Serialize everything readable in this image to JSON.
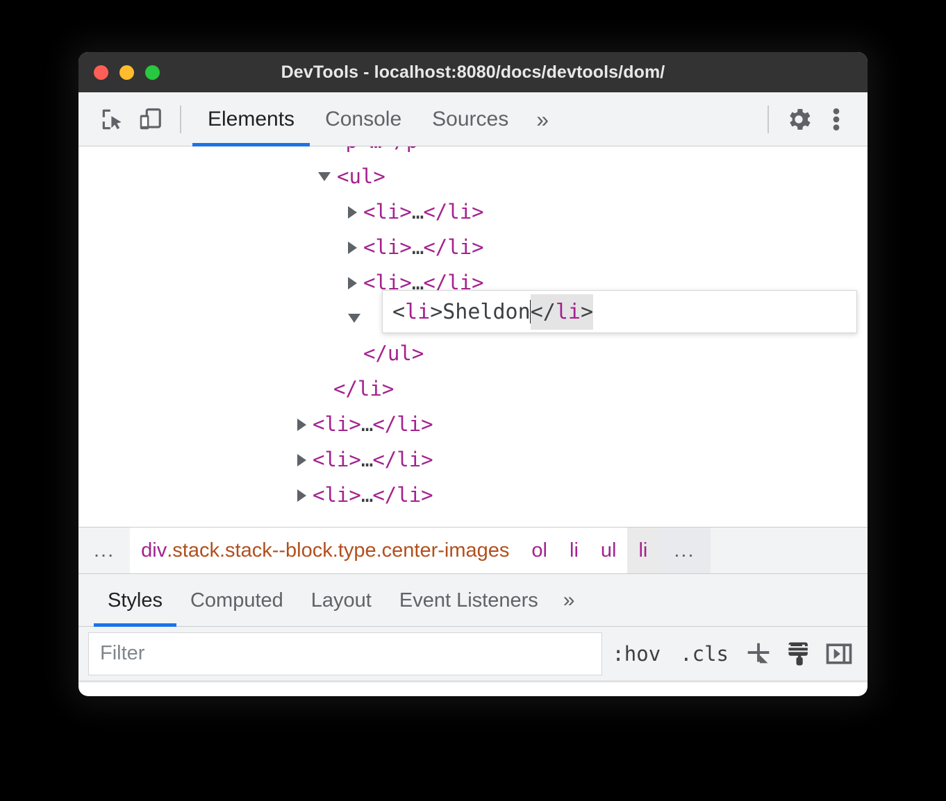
{
  "window": {
    "title": "DevTools - localhost:8080/docs/devtools/dom/",
    "traffic_lights": [
      "close-red",
      "minimize-amber",
      "maximize-green"
    ],
    "colors": {
      "titlebar_bg": "#333333",
      "red": "#ff5f57",
      "amber": "#ffbd2e",
      "green": "#28c840",
      "accent_blue": "#1a73e8",
      "tag_purple": "#a4228f",
      "class_orange": "#b1501d",
      "toolbar_bg": "#f1f3f4"
    }
  },
  "toolbar": {
    "icons": [
      {
        "name": "inspect-element-icon",
        "label": "Inspect element"
      },
      {
        "name": "device-toolbar-icon",
        "label": "Toggle device toolbar"
      }
    ],
    "tabs": [
      {
        "label": "Elements",
        "active": true
      },
      {
        "label": "Console",
        "active": false
      },
      {
        "label": "Sources",
        "active": false
      }
    ],
    "more_tabs": "»",
    "settings_icon": "gear-icon",
    "menu_icon": "three-dot-vertical-icon"
  },
  "dom_tree": {
    "rows": [
      {
        "indent": 3,
        "marker": "none",
        "text": "<p>…</p>",
        "clipped": true
      },
      {
        "indent": 3,
        "marker": "open",
        "text": "<ul>"
      },
      {
        "indent": 4,
        "marker": "closed",
        "text": "<li>…</li>"
      },
      {
        "indent": 4,
        "marker": "closed",
        "text": "<li>…</li>"
      },
      {
        "indent": 4,
        "marker": "closed",
        "text": "<li>…</li>"
      },
      {
        "indent": 4,
        "marker": "open",
        "text": ""
      },
      {
        "indent": 3,
        "marker": "none",
        "text": "</ul>"
      },
      {
        "indent": 2,
        "marker": "none",
        "text": "</li>"
      },
      {
        "indent": 2,
        "marker": "closed",
        "text": "<li>…</li>"
      },
      {
        "indent": 2,
        "marker": "closed",
        "text": "<li>…</li>"
      },
      {
        "indent": 2,
        "marker": "closed",
        "text": "<li>…</li>"
      }
    ]
  },
  "edit_box": {
    "open_punct_lt": "<",
    "open_tag": "li",
    "open_punct_gt": ">",
    "text": "Sheldon",
    "close_markup": "</li>",
    "close_punct_lt": "</",
    "close_tag": "li",
    "close_punct_gt": ">",
    "full_value": "<li>Sheldon</li>",
    "selection": "</li>",
    "caret_after": "Sheldon"
  },
  "breadcrumb": {
    "leading_ellipsis": "...",
    "trailing_ellipsis": "...",
    "crumbs": [
      {
        "tag": "div",
        "classes": ".stack.stack--block.type.center-images",
        "selected": false
      },
      {
        "tag": "ol",
        "classes": "",
        "selected": false
      },
      {
        "tag": "li",
        "classes": "",
        "selected": false
      },
      {
        "tag": "ul",
        "classes": "",
        "selected": false
      },
      {
        "tag": "li",
        "classes": "",
        "selected": true
      }
    ]
  },
  "styles_pane": {
    "tabs": [
      {
        "label": "Styles",
        "active": true
      },
      {
        "label": "Computed",
        "active": false
      },
      {
        "label": "Layout",
        "active": false
      },
      {
        "label": "Event Listeners",
        "active": false
      }
    ],
    "more_tabs": "»",
    "filter": {
      "value": "",
      "placeholder": "Filter"
    },
    "buttons": [
      {
        "label": ":hov",
        "name": "toggle-element-state-button"
      },
      {
        "label": ".cls",
        "name": "element-classes-button"
      }
    ],
    "icons": [
      {
        "name": "new-style-rule-plus-icon"
      },
      {
        "name": "paintbrush-icon"
      },
      {
        "name": "toggle-computed-sidebar-icon"
      }
    ]
  }
}
